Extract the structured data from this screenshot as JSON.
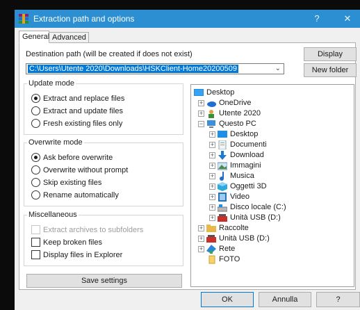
{
  "window": {
    "title": "Extraction path and options",
    "help_glyph": "?",
    "close_glyph": "✕",
    "accent_color": "#2b8fd1"
  },
  "tabs": [
    {
      "label": "General",
      "selected": true
    },
    {
      "label": "Advanced",
      "selected": false
    }
  ],
  "destination": {
    "label": "Destination path (will be created if does not exist)",
    "value": "C:\\Users\\Utente 2020\\Downloads\\HSKClient-Home20200509"
  },
  "buttons": {
    "display": "Display",
    "new_folder": "New folder",
    "save_settings": "Save settings",
    "ok": "OK",
    "cancel": "Annulla",
    "help": "?"
  },
  "update_mode": {
    "legend": "Update mode",
    "options": [
      {
        "label": "Extract and replace files",
        "selected": true
      },
      {
        "label": "Extract and update files",
        "selected": false
      },
      {
        "label": "Fresh existing files only",
        "selected": false
      }
    ]
  },
  "overwrite_mode": {
    "legend": "Overwrite mode",
    "options": [
      {
        "label": "Ask before overwrite",
        "selected": true
      },
      {
        "label": "Overwrite without prompt",
        "selected": false
      },
      {
        "label": "Skip existing files",
        "selected": false
      },
      {
        "label": "Rename automatically",
        "selected": false
      }
    ]
  },
  "miscellaneous": {
    "legend": "Miscellaneous",
    "options": [
      {
        "label": "Extract archives to subfolders",
        "checked": false,
        "disabled": true
      },
      {
        "label": "Keep broken files",
        "checked": false,
        "disabled": false
      },
      {
        "label": "Display files in Explorer",
        "checked": false,
        "disabled": false
      }
    ]
  },
  "tree": {
    "items": [
      {
        "label": "Desktop",
        "icon": "desktop-icon"
      },
      {
        "label": "OneDrive",
        "icon": "cloud-icon"
      },
      {
        "label": "Utente 2020",
        "icon": "user-icon"
      },
      {
        "label": "Questo PC",
        "icon": "computer-icon"
      },
      {
        "label": "Desktop",
        "icon": "desktop-icon"
      },
      {
        "label": "Documenti",
        "icon": "documents-icon"
      },
      {
        "label": "Download",
        "icon": "download-icon"
      },
      {
        "label": "Immagini",
        "icon": "pictures-icon"
      },
      {
        "label": "Musica",
        "icon": "music-icon"
      },
      {
        "label": "Oggetti 3D",
        "icon": "objects-3d-icon"
      },
      {
        "label": "Video",
        "icon": "video-icon"
      },
      {
        "label": "Disco locale (C:)",
        "icon": "drive-icon"
      },
      {
        "label": "Unità USB (D:)",
        "icon": "usb-drive-icon"
      },
      {
        "label": "Raccolte",
        "icon": "libraries-icon"
      },
      {
        "label": "Unità USB (D:)",
        "icon": "usb-drive-icon"
      },
      {
        "label": "Rete",
        "icon": "network-icon"
      },
      {
        "label": "FOTO",
        "icon": "folder-icon"
      }
    ]
  }
}
